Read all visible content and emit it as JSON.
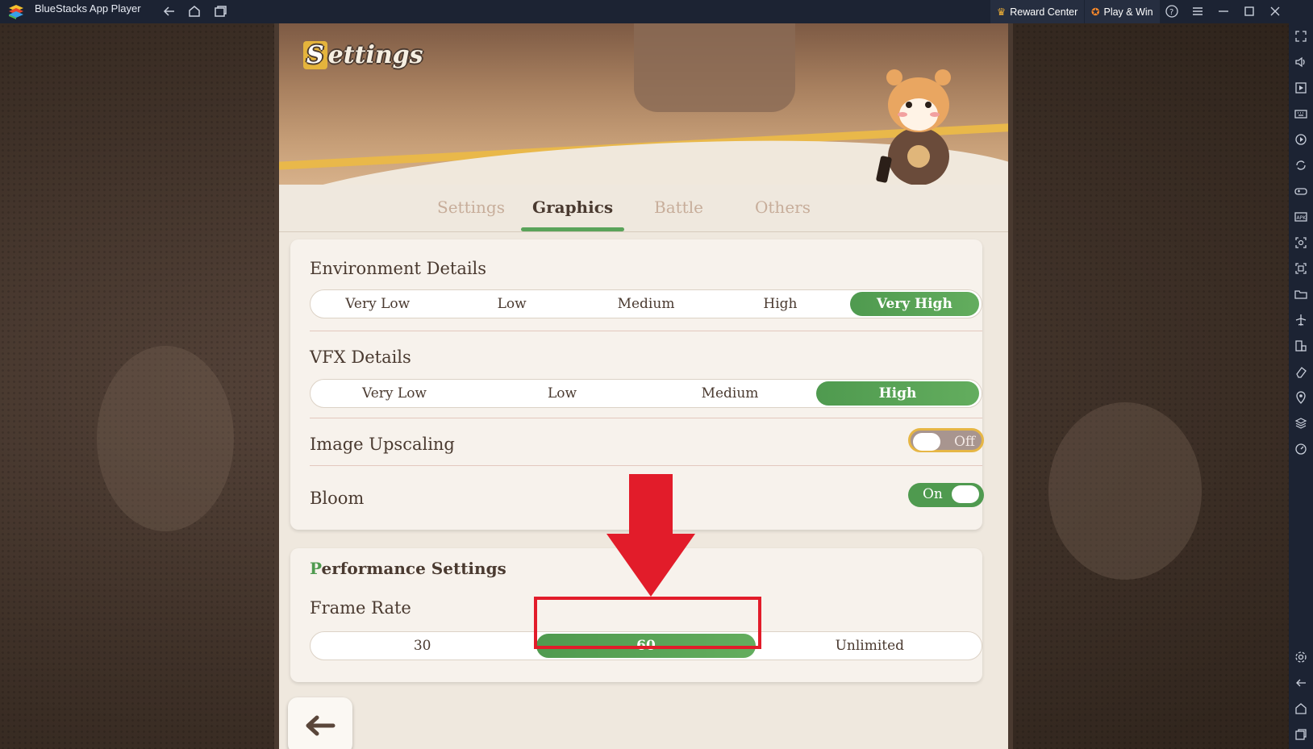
{
  "window": {
    "app_title": "BlueStacks App Player",
    "reward_center": "Reward Center",
    "play_win": "Play & Win"
  },
  "game": {
    "logo_rest": "ettings",
    "logo_first": "S",
    "tabs": [
      {
        "label": "Settings",
        "active": false
      },
      {
        "label": "Graphics",
        "active": true
      },
      {
        "label": "Battle",
        "active": false
      },
      {
        "label": "Others",
        "active": false
      }
    ],
    "environment_details": {
      "label": "Environment Details",
      "options": [
        "Very Low",
        "Low",
        "Medium",
        "High",
        "Very High"
      ],
      "selected": "Very High"
    },
    "vfx_details": {
      "label": "VFX Details",
      "options": [
        "Very Low",
        "Low",
        "Medium",
        "High"
      ],
      "selected": "High"
    },
    "image_upscaling": {
      "label": "Image Upscaling",
      "state": "Off"
    },
    "bloom": {
      "label": "Bloom",
      "state": "On"
    },
    "performance": {
      "title_first": "P",
      "title_rest": "erformance Settings",
      "frame_rate": {
        "label": "Frame Rate",
        "options": [
          "30",
          "60",
          "Unlimited"
        ],
        "selected": "60"
      }
    }
  },
  "colors": {
    "accent_green": "#4f9a4f",
    "annotation_red": "#e21c2a",
    "titlebar": "#1c2333"
  }
}
